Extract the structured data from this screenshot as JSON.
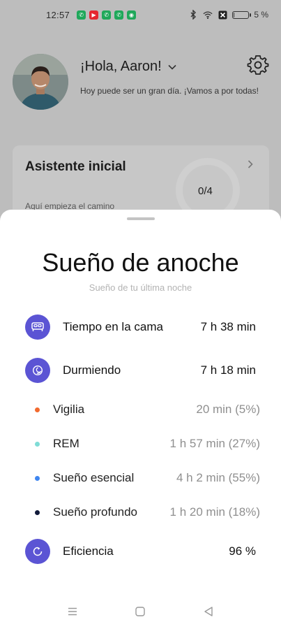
{
  "status_bar": {
    "time": "12:57",
    "battery_text": "5 %",
    "battery_level": 0.05,
    "notification_icons": [
      "whatsapp-icon",
      "youtube-icon",
      "whatsapp-icon",
      "whatsapp-icon",
      "phone-app-icon"
    ]
  },
  "header": {
    "greeting": "¡Hola, Aaron!",
    "subtitle": "Hoy puede ser un gran día. ¡Vamos a por todas!"
  },
  "card": {
    "title": "Asistente inicial",
    "subtitle": "Aquí empieza el camino",
    "progress": "0/4"
  },
  "sheet": {
    "title": "Sueño de anoche",
    "subtitle": "Sueño de tu última noche",
    "time_in_bed": {
      "label": "Tiempo en la cama",
      "value": "7 h 38 min"
    },
    "sleeping": {
      "label": "Durmiendo",
      "value": "7 h 18 min"
    },
    "stages": [
      {
        "label": "Vigilia",
        "value": "20 min (5%)",
        "color": "#f26a2e"
      },
      {
        "label": "REM",
        "value": "1 h 57 min (27%)",
        "color": "#7fdcd6"
      },
      {
        "label": "Sueño esencial",
        "value": "4 h 2 min (55%)",
        "color": "#3f86f0"
      },
      {
        "label": "Sueño profundo",
        "value": "1 h 20 min (18%)",
        "color": "#111a3a"
      }
    ],
    "efficiency": {
      "label": "Eficiencia",
      "value": "96 %"
    }
  },
  "colors": {
    "accent": "#5b54d4",
    "scrim": "#bdbdbd"
  }
}
